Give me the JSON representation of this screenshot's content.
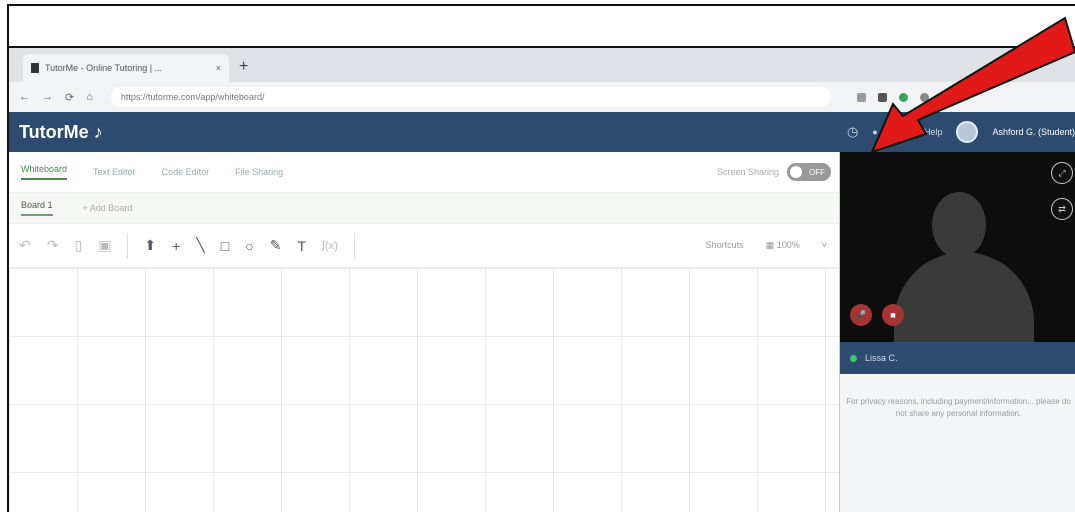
{
  "browser": {
    "tab_title": "TutorMe - Online Tutoring | ...",
    "new_tab": "+",
    "url": "https://tutorme.com/app/whiteboard/",
    "nav_back": "←",
    "nav_forward": "→",
    "nav_reload": "⟳",
    "nav_home": "⌂"
  },
  "header": {
    "logo": "TutorMe ♪",
    "end_label": "● End",
    "help_label": "❓ Help",
    "user_label": "Ashford G. (Student)"
  },
  "tabs": [
    "Whiteboard",
    "Text Editor",
    "Code Editor",
    "File Sharing"
  ],
  "screen_sharing": {
    "label": "Screen Sharing",
    "state": "OFF"
  },
  "boards": {
    "current": "Board 1",
    "add": "+ Add Board"
  },
  "toolbar": {
    "tools": [
      "↶",
      "↷",
      "▯",
      "▣",
      "⬆",
      "+",
      "╲",
      "□",
      "○",
      "✎",
      "T",
      "∫(x)"
    ],
    "shortcuts_label": "Shortcuts",
    "zoom_label": "▦ 100%",
    "collapse": "˅"
  },
  "video": {
    "mic_icon": "🎤",
    "cam_icon": "■",
    "expand_icon": "⤢",
    "switch_icon": "⇄"
  },
  "tutor": {
    "name": "Lissa C."
  },
  "notice": "For privacy reasons, including payment/information... please do not share any personal information."
}
